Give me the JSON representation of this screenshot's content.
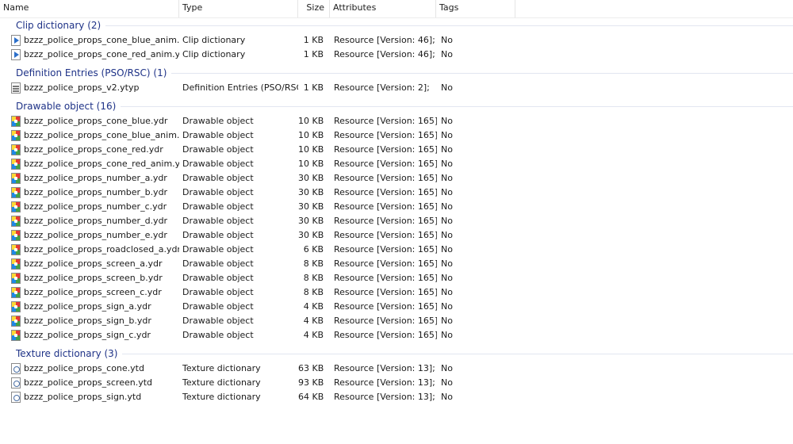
{
  "columns": {
    "name": "Name",
    "type": "Type",
    "size": "Size",
    "attributes": "Attributes",
    "tags": "Tags"
  },
  "groups": [
    {
      "title": "Clip dictionary (2)",
      "icon": "clip-dictionary-icon",
      "items": [
        {
          "name": "bzzz_police_props_cone_blue_anim.ycd",
          "type": "Clip dictionary",
          "size": "1 KB",
          "attributes": "Resource [Version: 46];",
          "tags": "No"
        },
        {
          "name": "bzzz_police_props_cone_red_anim.ycd",
          "type": "Clip dictionary",
          "size": "1 KB",
          "attributes": "Resource [Version: 46];",
          "tags": "No"
        }
      ]
    },
    {
      "title": "Definition Entries (PSO/RSC) (1)",
      "icon": "definition-file-icon",
      "items": [
        {
          "name": "bzzz_police_props_v2.ytyp",
          "type": "Definition Entries (PSO/RSC)",
          "size": "1 KB",
          "attributes": "Resource [Version: 2];",
          "tags": "No"
        }
      ]
    },
    {
      "title": "Drawable object (16)",
      "icon": "drawable-object-icon",
      "items": [
        {
          "name": "bzzz_police_props_cone_blue.ydr",
          "type": "Drawable object",
          "size": "10 KB",
          "attributes": "Resource [Version: 165];",
          "tags": "No"
        },
        {
          "name": "bzzz_police_props_cone_blue_anim.ydr",
          "type": "Drawable object",
          "size": "10 KB",
          "attributes": "Resource [Version: 165];",
          "tags": "No"
        },
        {
          "name": "bzzz_police_props_cone_red.ydr",
          "type": "Drawable object",
          "size": "10 KB",
          "attributes": "Resource [Version: 165];",
          "tags": "No"
        },
        {
          "name": "bzzz_police_props_cone_red_anim.ydr",
          "type": "Drawable object",
          "size": "10 KB",
          "attributes": "Resource [Version: 165];",
          "tags": "No"
        },
        {
          "name": "bzzz_police_props_number_a.ydr",
          "type": "Drawable object",
          "size": "30 KB",
          "attributes": "Resource [Version: 165];",
          "tags": "No"
        },
        {
          "name": "bzzz_police_props_number_b.ydr",
          "type": "Drawable object",
          "size": "30 KB",
          "attributes": "Resource [Version: 165];",
          "tags": "No"
        },
        {
          "name": "bzzz_police_props_number_c.ydr",
          "type": "Drawable object",
          "size": "30 KB",
          "attributes": "Resource [Version: 165];",
          "tags": "No"
        },
        {
          "name": "bzzz_police_props_number_d.ydr",
          "type": "Drawable object",
          "size": "30 KB",
          "attributes": "Resource [Version: 165];",
          "tags": "No"
        },
        {
          "name": "bzzz_police_props_number_e.ydr",
          "type": "Drawable object",
          "size": "30 KB",
          "attributes": "Resource [Version: 165];",
          "tags": "No"
        },
        {
          "name": "bzzz_police_props_roadclosed_a.ydr",
          "type": "Drawable object",
          "size": "6 KB",
          "attributes": "Resource [Version: 165];",
          "tags": "No"
        },
        {
          "name": "bzzz_police_props_screen_a.ydr",
          "type": "Drawable object",
          "size": "8 KB",
          "attributes": "Resource [Version: 165];",
          "tags": "No"
        },
        {
          "name": "bzzz_police_props_screen_b.ydr",
          "type": "Drawable object",
          "size": "8 KB",
          "attributes": "Resource [Version: 165];",
          "tags": "No"
        },
        {
          "name": "bzzz_police_props_screen_c.ydr",
          "type": "Drawable object",
          "size": "8 KB",
          "attributes": "Resource [Version: 165];",
          "tags": "No"
        },
        {
          "name": "bzzz_police_props_sign_a.ydr",
          "type": "Drawable object",
          "size": "4 KB",
          "attributes": "Resource [Version: 165];",
          "tags": "No"
        },
        {
          "name": "bzzz_police_props_sign_b.ydr",
          "type": "Drawable object",
          "size": "4 KB",
          "attributes": "Resource [Version: 165];",
          "tags": "No"
        },
        {
          "name": "bzzz_police_props_sign_c.ydr",
          "type": "Drawable object",
          "size": "4 KB",
          "attributes": "Resource [Version: 165];",
          "tags": "No"
        }
      ]
    },
    {
      "title": "Texture dictionary (3)",
      "icon": "texture-dictionary-icon",
      "items": [
        {
          "name": "bzzz_police_props_cone.ytd",
          "type": "Texture dictionary",
          "size": "63 KB",
          "attributes": "Resource [Version: 13];",
          "tags": "No"
        },
        {
          "name": "bzzz_police_props_screen.ytd",
          "type": "Texture dictionary",
          "size": "93 KB",
          "attributes": "Resource [Version: 13];",
          "tags": "No"
        },
        {
          "name": "bzzz_police_props_sign.ytd",
          "type": "Texture dictionary",
          "size": "64 KB",
          "attributes": "Resource [Version: 13];",
          "tags": "No"
        }
      ]
    }
  ]
}
